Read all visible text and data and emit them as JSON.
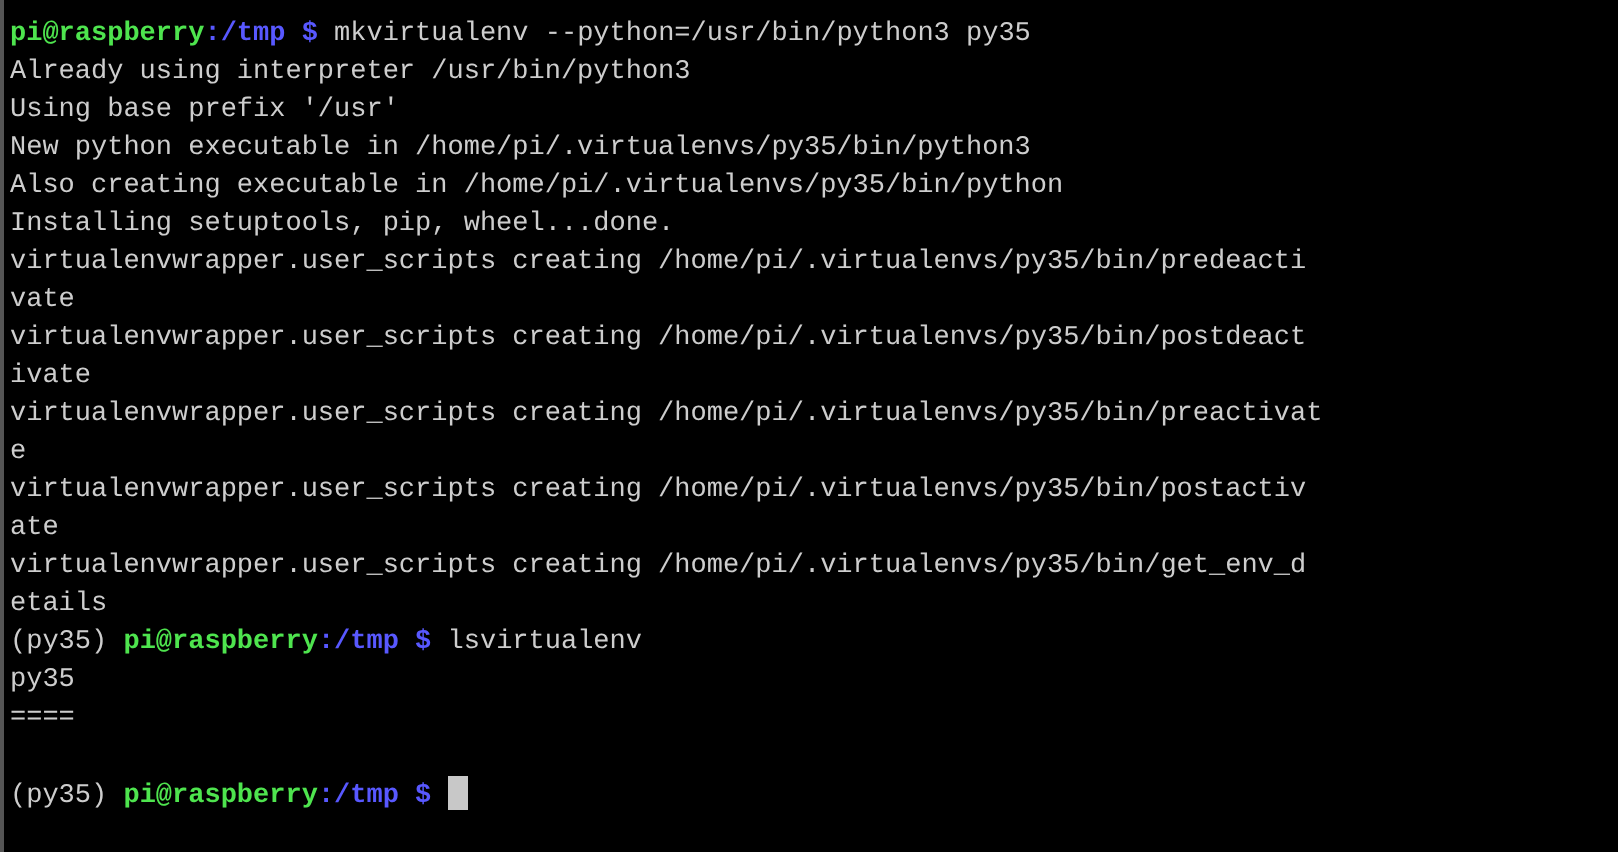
{
  "terminal": {
    "lines": [
      {
        "kind": "prompt",
        "user_host": "pi@raspberry",
        "path": ":/tmp $",
        "command": "mkvirtualenv --python=/usr/bin/python3 py35"
      },
      {
        "kind": "output",
        "text": "Already using interpreter /usr/bin/python3"
      },
      {
        "kind": "output",
        "text": "Using base prefix '/usr'"
      },
      {
        "kind": "output",
        "text": "New python executable in /home/pi/.virtualenvs/py35/bin/python3"
      },
      {
        "kind": "output",
        "text": "Also creating executable in /home/pi/.virtualenvs/py35/bin/python"
      },
      {
        "kind": "output",
        "text": "Installing setuptools, pip, wheel...done."
      },
      {
        "kind": "output",
        "text": "virtualenvwrapper.user_scripts creating /home/pi/.virtualenvs/py35/bin/predeacti"
      },
      {
        "kind": "output",
        "text": "vate"
      },
      {
        "kind": "output",
        "text": "virtualenvwrapper.user_scripts creating /home/pi/.virtualenvs/py35/bin/postdeact"
      },
      {
        "kind": "output",
        "text": "ivate"
      },
      {
        "kind": "output",
        "text": "virtualenvwrapper.user_scripts creating /home/pi/.virtualenvs/py35/bin/preactivat"
      },
      {
        "kind": "output",
        "text": "e"
      },
      {
        "kind": "output",
        "text": "virtualenvwrapper.user_scripts creating /home/pi/.virtualenvs/py35/bin/postactiv"
      },
      {
        "kind": "output",
        "text": "ate"
      },
      {
        "kind": "output",
        "text": "virtualenvwrapper.user_scripts creating /home/pi/.virtualenvs/py35/bin/get_env_d"
      },
      {
        "kind": "output",
        "text": "etails"
      },
      {
        "kind": "prompt",
        "env": "(py35)",
        "user_host": "pi@raspberry",
        "path": ":/tmp $",
        "command": "lsvirtualenv"
      },
      {
        "kind": "output",
        "text": "py35"
      },
      {
        "kind": "output",
        "text": "===="
      },
      {
        "kind": "blank"
      },
      {
        "kind": "prompt",
        "env": "(py35)",
        "user_host": "pi@raspberry",
        "path": ":/tmp $",
        "cursor": true
      }
    ]
  }
}
